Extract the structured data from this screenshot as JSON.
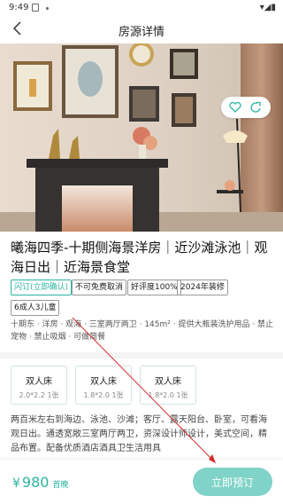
{
  "status_bar": {
    "time": "9:49",
    "right_icons": "▾◢▮"
  },
  "nav": {
    "title": "房源详情",
    "back_icon": "chevron-left-icon"
  },
  "hero": {
    "actions": [
      "heart-icon",
      "share-icon"
    ]
  },
  "house": {
    "title": "曦海四季-十期侧海景洋房｜近沙滩泳池｜观海日出｜近海景食堂",
    "tags": [
      {
        "label": "闪订(立即确认)",
        "style": "green"
      },
      {
        "label": "不可免费取消",
        "style": "plain"
      },
      {
        "label": "好评度100%",
        "style": "plain"
      },
      {
        "label": "2024年装修",
        "style": "plain"
      },
      {
        "label": "6成人3儿童",
        "style": "plain"
      }
    ],
    "description": "十期东 · 洋房 · 观海 · 三室两厅两卫 · 145m² · 提供大瓶装洗护用品 · 禁止宠物 · 禁止吸烟 · 可做简餐"
  },
  "beds": [
    {
      "name": "双人床",
      "size": "2.0*2.2 1张"
    },
    {
      "name": "双人床",
      "size": "1.8*2.0 1张"
    },
    {
      "name": "双人床",
      "size": "1.8*2.0 1张"
    }
  ],
  "intro": "两百米左右到海边、泳池、沙滩；客厅、露天阳台、卧室，可看海观日出。通透宽敞三室两厅两卫，资深设计师设计，美式空间，精品布置。配备优质酒店酒具卫生洁用具",
  "bottom_bar": {
    "currency": "¥",
    "price": "980",
    "unit": "首晚",
    "book_label": "立即预订"
  },
  "colors": {
    "accent": "#2bb3a3",
    "button": "#7fd3c8"
  }
}
